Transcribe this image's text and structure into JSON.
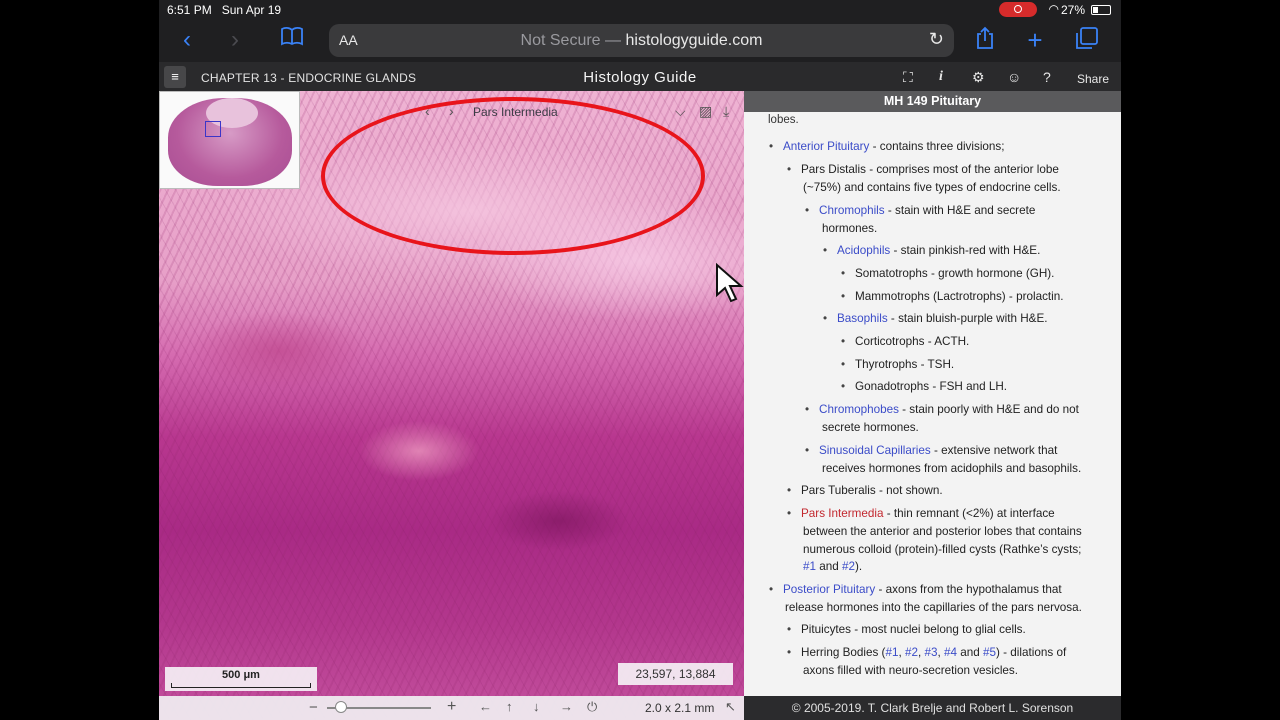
{
  "status": {
    "time": "6:51 PM",
    "date": "Sun Apr 19",
    "battery": "27%"
  },
  "browser": {
    "text_size": "AA",
    "security": "Not Secure",
    "separator": "—",
    "domain": "histologyguide.com"
  },
  "site": {
    "chapter": "CHAPTER 13 - ENDOCRINE GLANDS",
    "title": "Histology Guide",
    "share": "Share"
  },
  "viewer": {
    "region": "Pars Intermedia",
    "coords": "23,597,  13,884",
    "scale": "500 μm",
    "size": "2.0 x 2.1 mm",
    "zoom_out": "−",
    "zoom_in": "+"
  },
  "panel": {
    "title": "MH 149 Pituitary",
    "fragment": "lobes.",
    "items": [
      {
        "link": "Anterior Pituitary",
        "text": " - contains three divisions;"
      },
      {
        "text": "Pars Distalis - comprises most of the anterior lobe"
      },
      {
        "text": "(~75%) and contains five types of endocrine cells."
      },
      {
        "link": "Chromophils",
        "text": " - stain with H&E and secrete"
      },
      {
        "text": "hormones."
      },
      {
        "link": "Acidophils",
        "text": " - stain pinkish-red with H&E."
      },
      {
        "text": "Somatotrophs - growth hormone (GH)."
      },
      {
        "text": "Mammotrophs (Lactrotrophs) - prolactin."
      },
      {
        "link": "Basophils",
        "text": " - stain bluish-purple with H&E."
      },
      {
        "text": "Corticotrophs - ACTH."
      },
      {
        "text": "Thyrotrophs - TSH."
      },
      {
        "text": "Gonadotrophs - FSH and LH."
      },
      {
        "link": "Chromophobes",
        "text": " - stain poorly with H&E and do not"
      },
      {
        "text": "secrete hormones."
      },
      {
        "link": "Sinusoidal Capillaries",
        "text": " - extensive network that"
      },
      {
        "text": "receives hormones from acidophils and basophils."
      },
      {
        "text": "Pars Tuberalis - not shown."
      },
      {
        "link": "Pars Intermedia",
        "text": " - thin remnant (<2%) at interface"
      },
      {
        "text": "between the anterior and posterior lobes that contains"
      },
      {
        "text": "numerous colloid (protein)-filled cysts (Rathke’s cysts;"
      },
      {
        "link": "#1",
        "mid": " and ",
        "link2": "#2",
        "text": ")."
      },
      {
        "link": "Posterior Pituitary",
        "text": " - axons from the hypothalamus that"
      },
      {
        "text": "release hormones into the capillaries of the pars nervosa."
      },
      {
        "text": "Pituicytes - most nuclei belong to glial cells."
      },
      {
        "pre": "Herring Bodies (",
        "links": [
          "#1",
          "#2",
          "#3",
          "#4",
          "#5"
        ],
        "text": ") - dilations of"
      },
      {
        "text": "axons filled with neuro-secretion vesicles."
      }
    ]
  },
  "footer": "© 2005-2019. T. Clark Brelje and Robert L. Sorenson",
  "colors": {
    "link": "#3b4cc8",
    "highlight": "#c2282f",
    "annotation": "#e8141b",
    "safari_blue": "#3a82f7"
  }
}
